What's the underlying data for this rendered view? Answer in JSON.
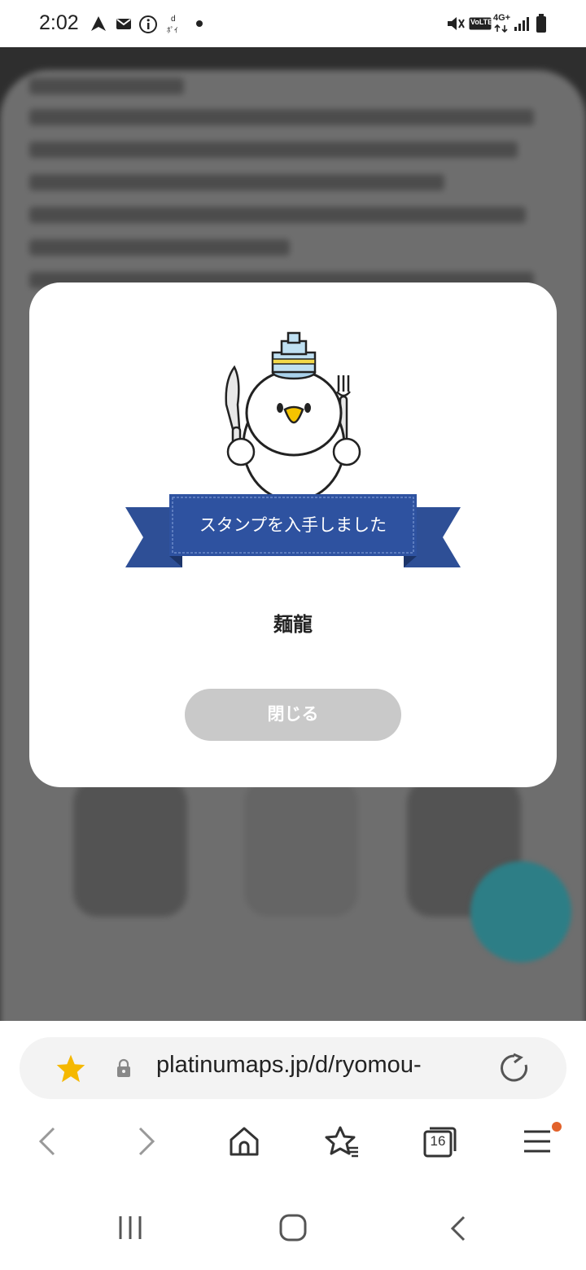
{
  "status_bar": {
    "time": "2:02",
    "network_label": "4G+",
    "volte_label": "VoLTE",
    "icons": [
      "navigation-icon",
      "mail-icon",
      "info-icon",
      "d-point-icon",
      "dot-icon",
      "mute-icon",
      "volte-icon",
      "signal-icon",
      "battery-icon"
    ]
  },
  "modal": {
    "ribbon_text": "スタンプを入手しました",
    "stamp_name": "麺龍",
    "close_label": "閉じる",
    "colors": {
      "ribbon": "#2e4f96",
      "ribbon_dark": "#223d7a",
      "button": "#c9c9c9"
    }
  },
  "browser": {
    "url": "platinumaps.jp/d/ryomou-",
    "tab_count": "16",
    "icons": [
      "favorite-star-icon",
      "lock-icon",
      "reload-icon",
      "back-icon",
      "forward-icon",
      "home-icon",
      "bookmarks-icon",
      "tabs-icon",
      "menu-icon"
    ],
    "accent": "#f5b800"
  },
  "system_nav": {
    "icons": [
      "recents-icon",
      "home-circle-icon",
      "system-back-icon"
    ]
  }
}
